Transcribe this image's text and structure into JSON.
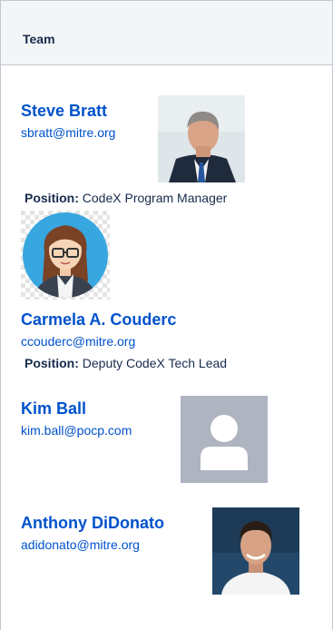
{
  "table": {
    "header": "Team"
  },
  "members": [
    {
      "name": "Steve Bratt",
      "email": "sbratt@mitre.org",
      "position_label": "Position:",
      "position_value": "CodeX Program Manager"
    },
    {
      "name": "Carmela A. Couderc",
      "email": "ccouderc@mitre.org",
      "position_label": "Position:",
      "position_value": "Deputy CodeX Tech Lead"
    },
    {
      "name": "Kim Ball",
      "email": "kim.ball@pocp.com"
    },
    {
      "name": "Anthony DiDonato",
      "email": "adidonato@mitre.org"
    }
  ],
  "colors": {
    "link": "#0052cc",
    "text": "#172b4d",
    "header_bg": "#f4f5f7",
    "border": "#c1c7d0",
    "placeholder_bg": "#aeb4c0"
  }
}
